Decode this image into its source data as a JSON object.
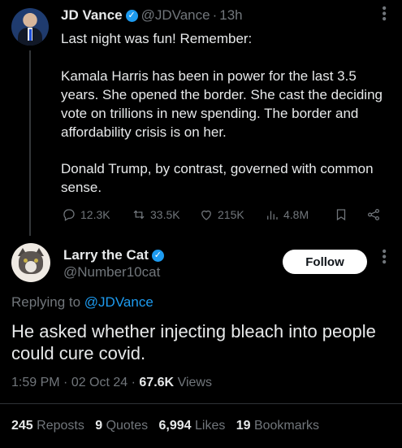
{
  "parent_tweet": {
    "author_name": "JD Vance",
    "handle": "@JDVance",
    "time_sep": "·",
    "time": "13h",
    "text_line0": "Last night was fun! Remember:",
    "text_para1": "Kamala Harris has been in power for the last 3.5 years. She opened the border. She cast the deciding vote on trillions in new spending. The border and affordability crisis is on her.",
    "text_para2": "Donald Trump, by contrast, governed with common sense.",
    "actions": {
      "replies": "12.3K",
      "reposts": "33.5K",
      "likes": "215K",
      "views": "4.8M"
    }
  },
  "reply_tweet": {
    "author_name": "Larry the Cat",
    "handle": "@Number10cat",
    "follow_label": "Follow",
    "replying_prefix": "Replying to",
    "replying_to": "@JDVance",
    "text": "He asked whether injecting bleach into people could cure covid.",
    "time": "1:59 PM",
    "date": "02 Oct 24",
    "views_count": "67.6K",
    "views_label": "Views",
    "stats": {
      "reposts_count": "245",
      "reposts_label": "Reposts",
      "quotes_count": "9",
      "quotes_label": "Quotes",
      "likes_count": "6,994",
      "likes_label": "Likes",
      "bookmarks_count": "19",
      "bookmarks_label": "Bookmarks"
    }
  },
  "colors": {
    "background": "#000000",
    "text": "#e7e9ea",
    "muted": "#71767b",
    "accent": "#1d9bf0"
  },
  "icons": [
    "verified-badge-icon",
    "more-icon",
    "reply-icon",
    "repost-icon",
    "like-icon",
    "views-icon",
    "bookmark-icon",
    "share-icon"
  ]
}
